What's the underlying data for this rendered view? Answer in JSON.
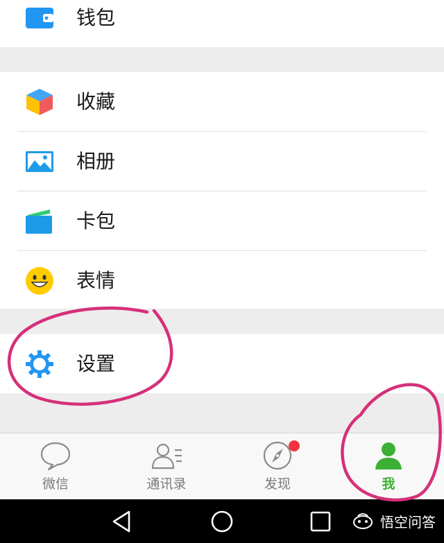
{
  "menu": {
    "wallet_label": "钱包",
    "favorites_label": "收藏",
    "album_label": "相册",
    "cards_label": "卡包",
    "stickers_label": "表情",
    "settings_label": "设置"
  },
  "tabbar": {
    "chats_label": "微信",
    "contacts_label": "通讯录",
    "discover_label": "发现",
    "me_label": "我",
    "active_tab": "me",
    "badge_color": "#f5333e"
  },
  "watermark": {
    "text": "悟空问答"
  },
  "colors": {
    "accent_green": "#3cb034",
    "icon_blue": "#2196f3",
    "annotation_pink": "#d6307a"
  }
}
